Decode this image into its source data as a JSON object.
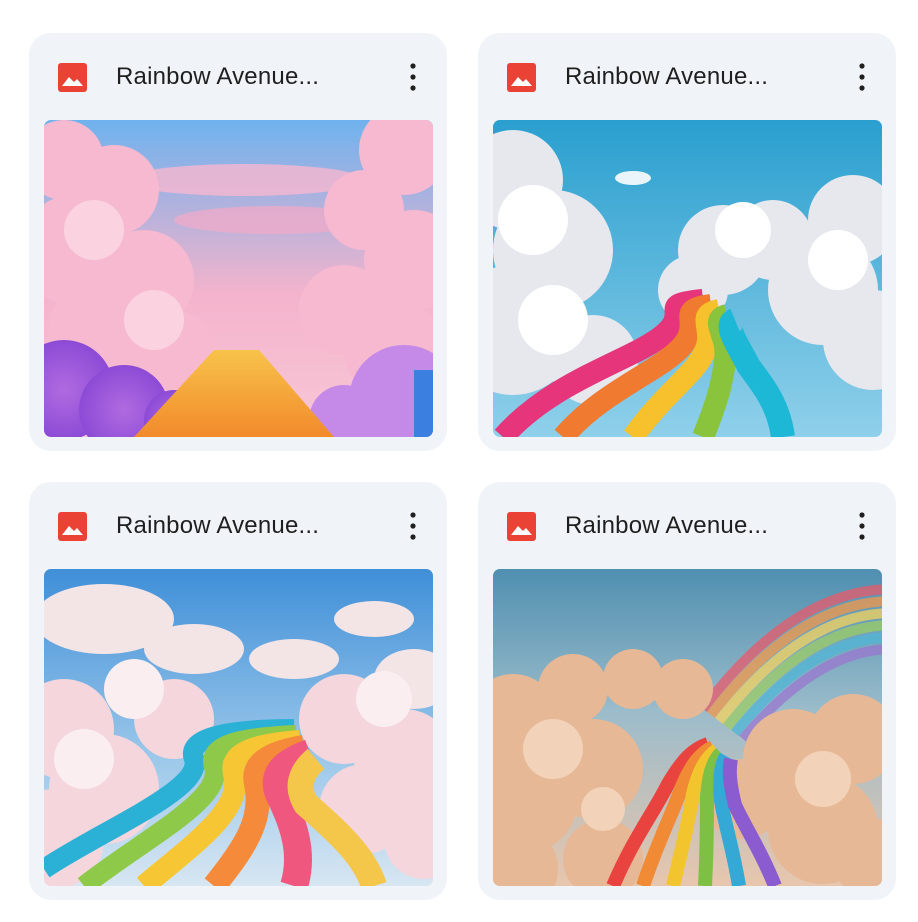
{
  "files": [
    {
      "title": "Rainbow Avenue...",
      "icon": "image-file-icon",
      "thumbnail": "pink clouds with orange path"
    },
    {
      "title": "Rainbow Avenue...",
      "icon": "image-file-icon",
      "thumbnail": "white clouds with winding rainbow road"
    },
    {
      "title": "Rainbow Avenue...",
      "icon": "image-file-icon",
      "thumbnail": "pastel clouds with rainbow road"
    },
    {
      "title": "Rainbow Avenue...",
      "icon": "image-file-icon",
      "thumbnail": "golden clouds with rainbow and road"
    }
  ],
  "colors": {
    "card_bg": "#f0f4f9",
    "icon_red": "#ea4335",
    "text": "#1f1f1f"
  }
}
